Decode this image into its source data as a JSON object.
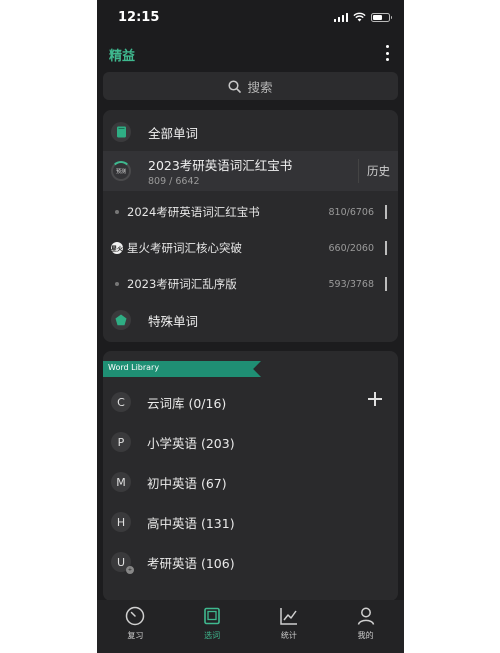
{
  "status": {
    "time": "12:15"
  },
  "header": {
    "brand": "精益"
  },
  "search": {
    "placeholder": "搜索"
  },
  "wordlist": {
    "all_words": "全部单词",
    "current": {
      "badge": "预测",
      "title": "2023考研英语词汇红宝书",
      "progress": "809 / 6642",
      "history_label": "历史"
    },
    "books": [
      {
        "title": "2024考研英语词汇红宝书",
        "count": "810/6706"
      },
      {
        "logo": "星火",
        "title": "星火考研词汇核心突破",
        "count": "660/2060"
      },
      {
        "title": "2023考研词汇乱序版",
        "count": "593/3768"
      }
    ],
    "special_words": "特殊单词"
  },
  "library": {
    "tag": "Word Library",
    "items": [
      {
        "letter": "C",
        "name": "云词库 (0/16)"
      },
      {
        "letter": "P",
        "name": "小学英语 (203)"
      },
      {
        "letter": "M",
        "name": "初中英语 (67)"
      },
      {
        "letter": "H",
        "name": "高中英语 (131)"
      },
      {
        "letter": "U",
        "name": "考研英语 (106)"
      }
    ]
  },
  "tabs": [
    {
      "label": "复习",
      "icon": "clock-icon"
    },
    {
      "label": "选词",
      "icon": "book-icon"
    },
    {
      "label": "统计",
      "icon": "chart-icon"
    },
    {
      "label": "我的",
      "icon": "user-icon"
    }
  ],
  "colors": {
    "accent": "#3fb98f",
    "tag": "#1f8f74",
    "background": "#1c1c1e"
  }
}
